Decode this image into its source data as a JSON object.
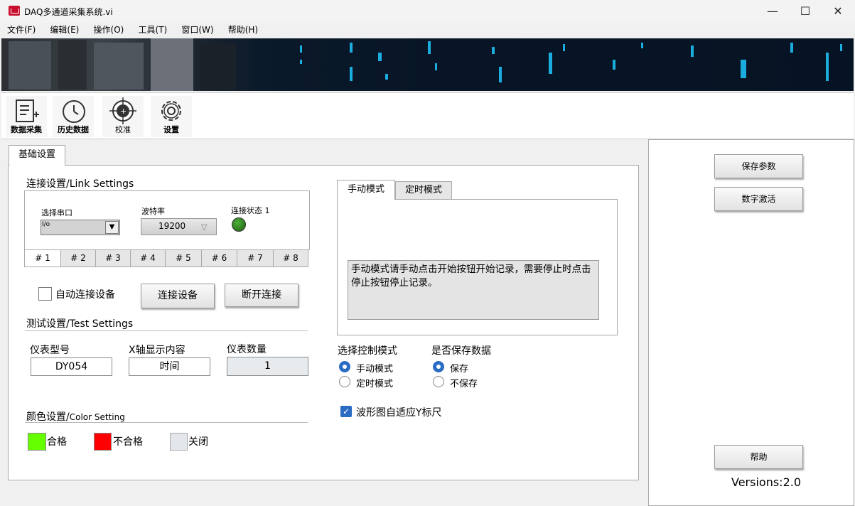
{
  "window": {
    "title": "DAQ多通道采集系统.vi",
    "controls": {
      "minimize": "—",
      "maximize": "☐",
      "close": "✕"
    }
  },
  "menu": [
    "文件(F)",
    "编辑(E)",
    "操作(O)",
    "工具(T)",
    "窗口(W)",
    "帮助(H)"
  ],
  "toolbar": {
    "items": [
      {
        "label": "数据采集",
        "icon": "document-edit-icon"
      },
      {
        "label": "历史数据",
        "icon": "history-clock-icon"
      },
      {
        "label": "校准",
        "icon": "crosshair-icon"
      },
      {
        "label": "设置",
        "icon": "gear-icon"
      }
    ]
  },
  "main_tab": "基础设置",
  "link": {
    "title": "连接设置/Link Settings",
    "port_label": "选择串口",
    "port_prefix": "I/o",
    "baud_label": "波特率",
    "baud_value": "19200",
    "status_label": "连接状态 1",
    "channels": [
      "# 1",
      "# 2",
      "# 3",
      "# 4",
      "# 5",
      "# 6",
      "# 7",
      "# 8"
    ],
    "auto_connect": "自动连接设备",
    "connect_btn": "连接设备",
    "disconnect_btn": "断开连接"
  },
  "test": {
    "title": "测试设置/Test Settings",
    "model_label": "仪表型号",
    "model_value": "DY054",
    "x_label": "X轴显示内容",
    "x_value": "时间",
    "count_label": "仪表数量",
    "count_value": "1"
  },
  "color": {
    "title": "颜色设置/",
    "title_small": "Color Setting",
    "items": [
      {
        "label": "合格",
        "color": "#66ff00"
      },
      {
        "label": "不合格",
        "color": "#ff0000"
      },
      {
        "label": "关闭",
        "color": "#e3e6ea"
      }
    ]
  },
  "mode": {
    "tabs": [
      "手动模式",
      "定时模式"
    ],
    "description": "手动模式请手动点击开始按钮开始记录，需要停止时点击停止按钮停止记录。",
    "control_label": "选择控制模式",
    "control_options": [
      "手动模式",
      "定时模式"
    ],
    "save_label": "是否保存数据",
    "save_options": [
      "保存",
      "不保存"
    ],
    "autoscale": "波形图自适应Y标尺"
  },
  "right": {
    "save_params": "保存参数",
    "activate": "数字激活",
    "help": "帮助",
    "version": "Versions:2.0"
  },
  "colors": {
    "accent": "#2a6cc4",
    "led": "#1f7a10"
  }
}
